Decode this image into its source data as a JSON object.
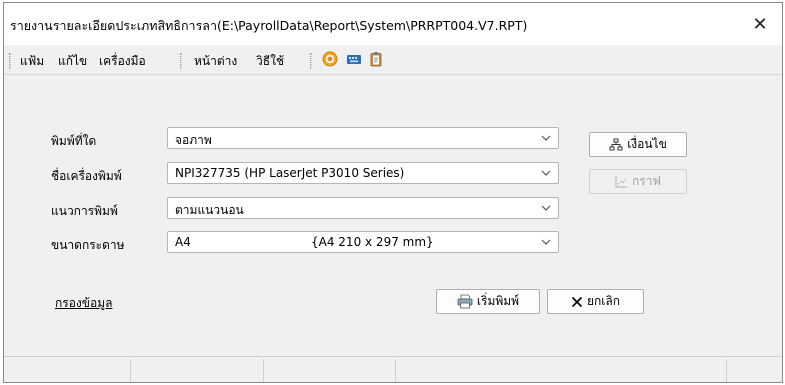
{
  "window": {
    "title": "รายงานรายละเอียดประเภทสิทธิการลา(E:\\PayrollData\\Report\\System\\PRRPT004.V7.RPT)",
    "close_glyph": "✕"
  },
  "menu": {
    "file": "แฟ้ม",
    "edit": "แก้ไข",
    "tools": "เครื่องมือ",
    "window": "หน้าต่าง",
    "help": "วิธีใช้"
  },
  "toolbar": {
    "icons": [
      "target-icon",
      "keyboard-icon",
      "clipboard-icon"
    ],
    "colors": {
      "target": "#f5a623",
      "keyboard": "#2f6fb5"
    }
  },
  "form": {
    "print_to_label": "พิมพ์ที่ใด",
    "print_to_value": "จอภาพ",
    "printer_label": "ชื่อเครื่องพิมพ์",
    "printer_value": "NPI327735 (HP LaserJet P3010 Series)",
    "orientation_label": "แนวการพิมพ์",
    "orientation_value": "ตามแนวนอน",
    "paper_label": "ขนาดกระดาษ",
    "paper_value": "A4",
    "paper_detail": "{A4 210 x 297 mm}"
  },
  "buttons": {
    "condition": "เงื่อนไข",
    "graph": "กราฟ",
    "start_print": "เริ่มพิมพ์",
    "cancel": "ยกเลิก"
  },
  "links": {
    "filter_data": "กรองข้อมูล"
  }
}
